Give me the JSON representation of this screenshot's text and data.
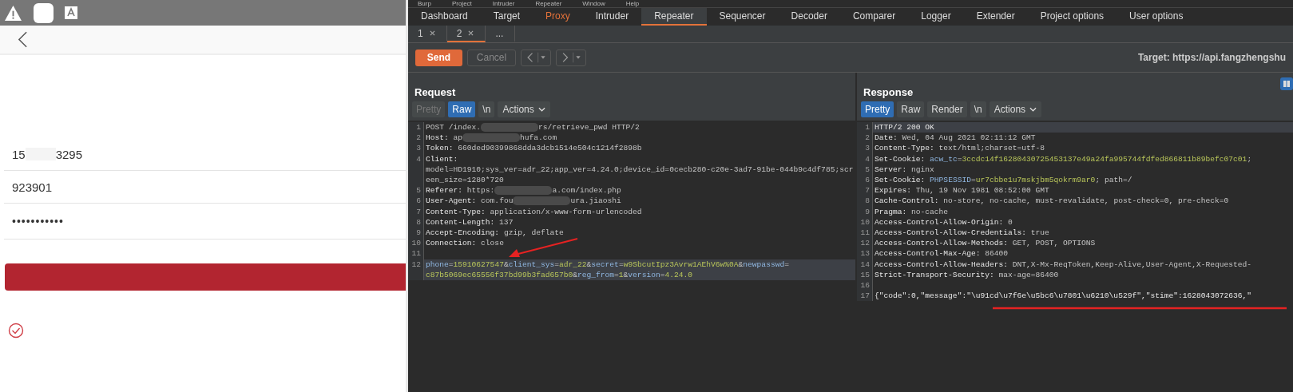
{
  "phone": {
    "fields": [
      {
        "kind": "text",
        "segments": [
          {
            "kind": "text",
            "text": "15"
          },
          {
            "kind": "redacted"
          },
          {
            "kind": "text",
            "text": "3295"
          }
        ]
      },
      {
        "kind": "text",
        "segments": [
          {
            "kind": "text",
            "text": "923901"
          }
        ]
      },
      {
        "kind": "password",
        "segments": [
          {
            "kind": "text",
            "text": "•••••••••••"
          }
        ]
      }
    ]
  },
  "burp": {
    "menu": [
      "Burp",
      "Project",
      "Intruder",
      "Repeater",
      "Window",
      "Help"
    ],
    "tabs": [
      {
        "label": "Dashboard",
        "selected": false,
        "highlighted": false
      },
      {
        "label": "Target",
        "selected": false,
        "highlighted": false
      },
      {
        "label": "Proxy",
        "selected": false,
        "highlighted": true
      },
      {
        "label": "Intruder",
        "selected": false,
        "highlighted": false
      },
      {
        "label": "Repeater",
        "selected": true,
        "highlighted": false
      },
      {
        "label": "Sequencer",
        "selected": false,
        "highlighted": false
      },
      {
        "label": "Decoder",
        "selected": false,
        "highlighted": false
      },
      {
        "label": "Comparer",
        "selected": false,
        "highlighted": false
      },
      {
        "label": "Logger",
        "selected": false,
        "highlighted": false
      },
      {
        "label": "Extender",
        "selected": false,
        "highlighted": false
      },
      {
        "label": "Project options",
        "selected": false,
        "highlighted": false
      },
      {
        "label": "User options",
        "selected": false,
        "highlighted": false
      }
    ],
    "repeater_tabs": [
      {
        "label": "1",
        "selected": false,
        "closable": true
      },
      {
        "label": "2",
        "selected": true,
        "closable": true
      },
      {
        "label": "...",
        "selected": false,
        "closable": false
      }
    ],
    "toolbar": {
      "send": "Send",
      "cancel": {
        "label": "Cancel",
        "disabled": true
      },
      "target": "Target: https://api.fangzhengshu"
    },
    "request": {
      "title": "Request",
      "view_tabs": [
        {
          "label": "Pretty",
          "selected": false,
          "disabled": true
        },
        {
          "label": "Raw",
          "selected": true,
          "disabled": false
        },
        {
          "label": "\\n",
          "selected": false,
          "disabled": false
        }
      ],
      "actions": "Actions",
      "lines": [
        {
          "number": "1",
          "selected": false,
          "segments": [
            {
              "kind": "text",
              "text": "POST /index."
            },
            {
              "kind": "redacted"
            },
            {
              "kind": "text",
              "text": "rs/retrieve_pwd HTTP/2"
            }
          ]
        },
        {
          "number": "2",
          "selected": false,
          "segments": [
            {
              "kind": "name",
              "text": "Host:"
            },
            {
              "kind": "text",
              "text": " ap"
            },
            {
              "kind": "redacted"
            },
            {
              "kind": "text",
              "text": "hufa.com"
            }
          ]
        },
        {
          "number": "3",
          "selected": false,
          "segments": [
            {
              "kind": "name",
              "text": "Token:"
            },
            {
              "kind": "text",
              "text": " 660ded90399868dda3dcb1514e504c1214f2898b"
            }
          ]
        },
        {
          "number": "4",
          "selected": false,
          "segments": [
            {
              "kind": "name",
              "text": "Client:"
            },
            {
              "kind": "wrap"
            },
            {
              "kind": "text",
              "text": "model=HD1910;sys_ver=adr_22;app_ver=4.24.0;device_id=0cecb280-c20e-3ad7-91be-044b9c4df785;scr"
            },
            {
              "kind": "wrap"
            },
            {
              "kind": "text",
              "text": "een_size=1280*720"
            }
          ]
        },
        {
          "number": "5",
          "selected": false,
          "segments": [
            {
              "kind": "name",
              "text": "Referer:"
            },
            {
              "kind": "text",
              "text": " https:"
            },
            {
              "kind": "redacted"
            },
            {
              "kind": "text",
              "text": "a.com/index.php"
            }
          ]
        },
        {
          "number": "6",
          "selected": false,
          "segments": [
            {
              "kind": "name",
              "text": "User-Agent:"
            },
            {
              "kind": "text",
              "text": " com.fou"
            },
            {
              "kind": "redacted"
            },
            {
              "kind": "text",
              "text": "ura.jiaoshi"
            }
          ]
        },
        {
          "number": "7",
          "selected": false,
          "segments": [
            {
              "kind": "name",
              "text": "Content-Type:"
            },
            {
              "kind": "text",
              "text": " application/x-www-form-urlencoded"
            }
          ]
        },
        {
          "number": "8",
          "selected": false,
          "segments": [
            {
              "kind": "name",
              "text": "Content-Length:"
            },
            {
              "kind": "text",
              "text": " 137"
            }
          ]
        },
        {
          "number": "9",
          "selected": false,
          "segments": [
            {
              "kind": "name",
              "text": "Accept-Encoding:"
            },
            {
              "kind": "text",
              "text": " gzip, deflate"
            }
          ]
        },
        {
          "number": "10",
          "selected": false,
          "segments": [
            {
              "kind": "name",
              "text": "Connection:"
            },
            {
              "kind": "text",
              "text": " close"
            }
          ]
        },
        {
          "number": "11",
          "selected": false
        },
        {
          "number": "12",
          "selected": true,
          "segments": [
            {
              "kind": "param",
              "text": "phone"
            },
            {
              "kind": "text",
              "text": "="
            },
            {
              "kind": "value",
              "text": "15910627547"
            },
            {
              "kind": "text",
              "text": "&"
            },
            {
              "kind": "param",
              "text": "client_sys"
            },
            {
              "kind": "text",
              "text": "="
            },
            {
              "kind": "value",
              "text": "adr_22"
            },
            {
              "kind": "text",
              "text": "&"
            },
            {
              "kind": "param",
              "text": "secret"
            },
            {
              "kind": "text",
              "text": "="
            },
            {
              "kind": "value",
              "text": "w9SbcutIpz3Avrw1AEhV6w%0A"
            },
            {
              "kind": "text",
              "text": "&"
            },
            {
              "kind": "param",
              "text": "newpasswd"
            },
            {
              "kind": "text",
              "text": "="
            },
            {
              "kind": "wrap"
            },
            {
              "kind": "value",
              "text": "c87b5069ec65556f37bd99b3fad657b0"
            },
            {
              "kind": "text",
              "text": "&"
            },
            {
              "kind": "param",
              "text": "reg_from"
            },
            {
              "kind": "text",
              "text": "="
            },
            {
              "kind": "value",
              "text": "1"
            },
            {
              "kind": "text",
              "text": "&"
            },
            {
              "kind": "param",
              "text": "version"
            },
            {
              "kind": "text",
              "text": "="
            },
            {
              "kind": "value",
              "text": "4.24.0"
            }
          ]
        }
      ]
    },
    "response": {
      "title": "Response",
      "view_tabs": [
        {
          "label": "Pretty",
          "selected": true,
          "disabled": false
        },
        {
          "label": "Raw",
          "selected": false,
          "disabled": false
        },
        {
          "label": "Render",
          "selected": false,
          "disabled": false
        },
        {
          "label": "\\n",
          "selected": false,
          "disabled": false
        }
      ],
      "actions": "Actions",
      "lines": [
        {
          "number": "1",
          "selected": true,
          "segments": [
            {
              "kind": "name",
              "text": "HTTP/2 200 OK"
            }
          ]
        },
        {
          "number": "2",
          "selected": false,
          "segments": [
            {
              "kind": "name",
              "text": "Date:"
            },
            {
              "kind": "text",
              "text": " Wed, 04 Aug 2021 02:11:12 GMT"
            }
          ]
        },
        {
          "number": "3",
          "selected": false,
          "segments": [
            {
              "kind": "name",
              "text": "Content-Type:"
            },
            {
              "kind": "text",
              "text": " text/html;charset=utf-8"
            }
          ]
        },
        {
          "number": "4",
          "selected": false,
          "segments": [
            {
              "kind": "name",
              "text": "Set-Cookie:"
            },
            {
              "kind": "param",
              "text": " acw_tc"
            },
            {
              "kind": "text",
              "text": "="
            },
            {
              "kind": "value",
              "text": "3ccdc14f16280430725453137e49a24fa995744fdfed866811b89befc07c01"
            },
            {
              "kind": "text",
              "text": ";"
            }
          ]
        },
        {
          "number": "5",
          "selected": false,
          "segments": [
            {
              "kind": "name",
              "text": "Server:"
            },
            {
              "kind": "text",
              "text": " nginx"
            }
          ]
        },
        {
          "number": "6",
          "selected": false,
          "segments": [
            {
              "kind": "name",
              "text": "Set-Cookie:"
            },
            {
              "kind": "param",
              "text": " PHPSESSID"
            },
            {
              "kind": "text",
              "text": "="
            },
            {
              "kind": "value",
              "text": "ur7cbbe1u7mskjbm5qokrm9ar0"
            },
            {
              "kind": "text",
              "text": "; path=/"
            }
          ]
        },
        {
          "number": "7",
          "selected": false,
          "segments": [
            {
              "kind": "name",
              "text": "Expires:"
            },
            {
              "kind": "text",
              "text": " Thu, 19 Nov 1981 08:52:00 GMT"
            }
          ]
        },
        {
          "number": "8",
          "selected": false,
          "segments": [
            {
              "kind": "name",
              "text": "Cache-Control:"
            },
            {
              "kind": "text",
              "text": " no-store, no-cache, must-revalidate, post-check=0, pre-check=0"
            }
          ]
        },
        {
          "number": "9",
          "selected": false,
          "segments": [
            {
              "kind": "name",
              "text": "Pragma:"
            },
            {
              "kind": "text",
              "text": " no-cache"
            }
          ]
        },
        {
          "number": "10",
          "selected": false,
          "segments": [
            {
              "kind": "name",
              "text": "Access-Control-Allow-Origin:"
            },
            {
              "kind": "text",
              "text": " 0"
            }
          ]
        },
        {
          "number": "11",
          "selected": false,
          "segments": [
            {
              "kind": "name",
              "text": "Access-Control-Allow-Credentials:"
            },
            {
              "kind": "text",
              "text": " true"
            }
          ]
        },
        {
          "number": "12",
          "selected": false,
          "segments": [
            {
              "kind": "name",
              "text": "Access-Control-Allow-Methods:"
            },
            {
              "kind": "text",
              "text": " GET, POST, OPTIONS"
            }
          ]
        },
        {
          "number": "13",
          "selected": false,
          "segments": [
            {
              "kind": "name",
              "text": "Access-Control-Max-Age:"
            },
            {
              "kind": "text",
              "text": " 86400"
            }
          ]
        },
        {
          "number": "14",
          "selected": false,
          "segments": [
            {
              "kind": "name",
              "text": "Access-Control-Allow-Headers:"
            },
            {
              "kind": "text",
              "text": " DNT,X-Mx-ReqToken,Keep-Alive,User-Agent,X-Requested-"
            }
          ]
        },
        {
          "number": "15",
          "selected": false,
          "segments": [
            {
              "kind": "name",
              "text": "Strict-Transport-Security:"
            },
            {
              "kind": "text",
              "text": " max-age=86400"
            }
          ]
        },
        {
          "number": "16",
          "selected": false
        },
        {
          "number": "17",
          "selected": false,
          "segments": [
            {
              "kind": "name",
              "text": "{\"code\":0,\"message\":\"\\u91cd\\u7f6e\\u5bc6\\u7801\\u6210\\u529f\",\"stime\":1628043072636,\""
            }
          ]
        }
      ]
    }
  }
}
